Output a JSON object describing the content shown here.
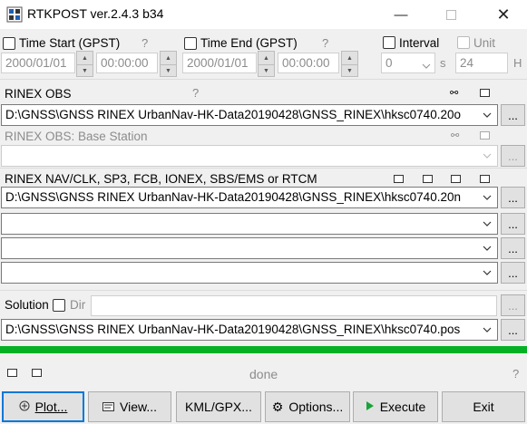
{
  "window": {
    "title": "RTKPOST ver.2.4.3 b34"
  },
  "time_start": {
    "label": "Time Start (GPST)",
    "help": "?",
    "date": "2000/01/01",
    "time": "00:00:00"
  },
  "time_end": {
    "label": "Time End (GPST)",
    "help": "?",
    "date": "2000/01/01",
    "time": "00:00:00"
  },
  "interval": {
    "label": "Interval",
    "value": "0",
    "unit": "s"
  },
  "unit": {
    "label": "Unit",
    "value": "24",
    "unit": "H"
  },
  "rinex_obs": {
    "label": "RINEX OBS",
    "help": "?",
    "path": "D:\\GNSS\\GNSS RINEX UrbanNav-HK-Data20190428\\GNSS_RINEX\\hksc0740.20o",
    "browse": "..."
  },
  "rinex_base": {
    "label": "RINEX OBS: Base Station",
    "path": "",
    "browse": "..."
  },
  "rinex_nav": {
    "label": "RINEX NAV/CLK, SP3, FCB, IONEX, SBS/EMS  or RTCM",
    "paths": [
      "D:\\GNSS\\GNSS RINEX UrbanNav-HK-Data20190428\\GNSS_RINEX\\hksc0740.20n",
      "",
      "",
      ""
    ],
    "browse": "..."
  },
  "solution": {
    "label": "Solution",
    "dir_label": "Dir",
    "dir_value": "",
    "path": "D:\\GNSS\\GNSS RINEX UrbanNav-HK-Data20190428\\GNSS_RINEX\\hksc0740.pos",
    "browse": "..."
  },
  "status": {
    "text": "done",
    "help": "?",
    "progress": 1.0,
    "progress_color": "#06b025"
  },
  "buttons": {
    "plot": "Plot...",
    "view": "View...",
    "kml": "KML/GPX...",
    "options": "Options...",
    "execute": "Execute",
    "exit": "Exit"
  },
  "icons": [
    "app-icon",
    "minimize-icon",
    "maximize-icon",
    "close-icon",
    "plot-icon",
    "view-icon",
    "options-gear-icon",
    "execute-play-icon"
  ]
}
